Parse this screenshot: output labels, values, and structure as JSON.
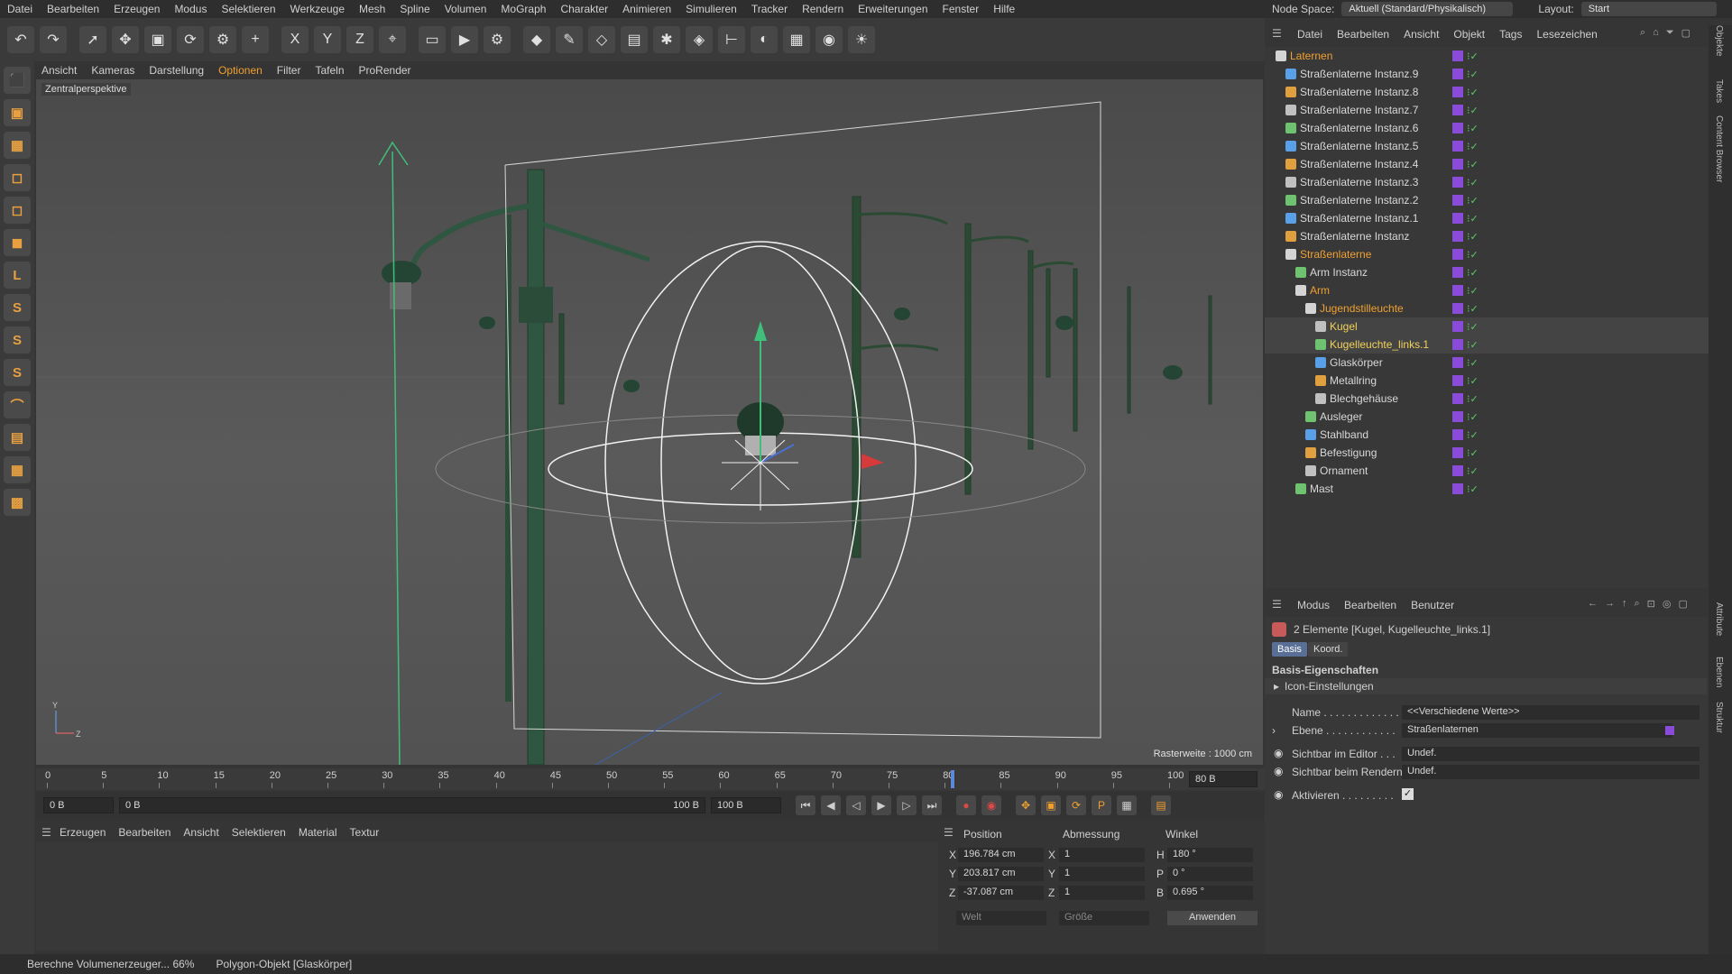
{
  "menu": [
    "Datei",
    "Bearbeiten",
    "Erzeugen",
    "Modus",
    "Selektieren",
    "Werkzeuge",
    "Mesh",
    "Spline",
    "Volumen",
    "MoGraph",
    "Charakter",
    "Animieren",
    "Simulieren",
    "Tracker",
    "Rendern",
    "Erweiterungen",
    "Fenster",
    "Hilfe"
  ],
  "top_right": {
    "node_space_label": "Node Space:",
    "node_space_value": "Aktuell (Standard/Physikalisch)",
    "layout_label": "Layout:",
    "layout_value": "Start"
  },
  "viewport": {
    "menu": [
      "Ansicht",
      "Kameras",
      "Darstellung",
      "Optionen",
      "Filter",
      "Tafeln",
      "ProRender"
    ],
    "active_menu": "Optionen",
    "label": "Zentralperspektive",
    "raster": "Rasterweite : 1000 cm"
  },
  "timeline": {
    "ticks": [
      "0",
      "5",
      "10",
      "15",
      "20",
      "25",
      "30",
      "35",
      "40",
      "45",
      "50",
      "55",
      "60",
      "65",
      "70",
      "75",
      "80",
      "85",
      "90",
      "95",
      "100"
    ],
    "current_frame": "80 B",
    "start": "0 B",
    "range_start": "0 B",
    "range_end": "100 B",
    "end": "100 B"
  },
  "material_menu": [
    "Erzeugen",
    "Bearbeiten",
    "Ansicht",
    "Selektieren",
    "Material",
    "Textur"
  ],
  "coords": {
    "headers": [
      "Position",
      "Abmessung",
      "Winkel"
    ],
    "rows": [
      {
        "axis": "X",
        "pos": "196.784 cm",
        "dim_axis": "X",
        "dim": "1",
        "ang_axis": "H",
        "ang": "180 °"
      },
      {
        "axis": "Y",
        "pos": "203.817 cm",
        "dim_axis": "Y",
        "dim": "1",
        "ang_axis": "P",
        "ang": "0 °"
      },
      {
        "axis": "Z",
        "pos": "-37.087 cm",
        "dim_axis": "Z",
        "dim": "1",
        "ang_axis": "B",
        "ang": "0.695 °"
      }
    ],
    "mode1": "Welt",
    "mode2": "Größe",
    "apply": "Anwenden"
  },
  "status": {
    "progress": "Berechne Volumenerzeuger... 66%",
    "selection": "Polygon-Objekt [Glaskörper]"
  },
  "objects_menu": [
    "Datei",
    "Bearbeiten",
    "Ansicht",
    "Objekt",
    "Tags",
    "Lesezeichen"
  ],
  "objects": [
    {
      "name": "Laternen",
      "indent": 0,
      "style": "orange"
    },
    {
      "name": "Straßenlaterne Instanz.9",
      "indent": 1,
      "style": "normal"
    },
    {
      "name": "Straßenlaterne Instanz.8",
      "indent": 1,
      "style": "normal"
    },
    {
      "name": "Straßenlaterne Instanz.7",
      "indent": 1,
      "style": "normal"
    },
    {
      "name": "Straßenlaterne Instanz.6",
      "indent": 1,
      "style": "normal"
    },
    {
      "name": "Straßenlaterne Instanz.5",
      "indent": 1,
      "style": "normal"
    },
    {
      "name": "Straßenlaterne Instanz.4",
      "indent": 1,
      "style": "normal"
    },
    {
      "name": "Straßenlaterne Instanz.3",
      "indent": 1,
      "style": "normal"
    },
    {
      "name": "Straßenlaterne Instanz.2",
      "indent": 1,
      "style": "normal"
    },
    {
      "name": "Straßenlaterne Instanz.1",
      "indent": 1,
      "style": "normal"
    },
    {
      "name": "Straßenlaterne Instanz",
      "indent": 1,
      "style": "normal"
    },
    {
      "name": "Straßenlaterne",
      "indent": 1,
      "style": "orange"
    },
    {
      "name": "Arm Instanz",
      "indent": 2,
      "style": "normal"
    },
    {
      "name": "Arm",
      "indent": 2,
      "style": "orange"
    },
    {
      "name": "Jugendstilleuchte",
      "indent": 3,
      "style": "orange"
    },
    {
      "name": "Kugel",
      "indent": 4,
      "style": "yellow"
    },
    {
      "name": "Kugelleuchte_links.1",
      "indent": 4,
      "style": "yellow"
    },
    {
      "name": "Glaskörper",
      "indent": 4,
      "style": "normal"
    },
    {
      "name": "Metallring",
      "indent": 4,
      "style": "normal"
    },
    {
      "name": "Blechgehäuse",
      "indent": 4,
      "style": "normal"
    },
    {
      "name": "Ausleger",
      "indent": 3,
      "style": "normal"
    },
    {
      "name": "Stahlband",
      "indent": 3,
      "style": "normal"
    },
    {
      "name": "Befestigung",
      "indent": 3,
      "style": "normal"
    },
    {
      "name": "Ornament",
      "indent": 3,
      "style": "normal"
    },
    {
      "name": "Mast",
      "indent": 2,
      "style": "normal"
    }
  ],
  "attr_menu": [
    "Modus",
    "Bearbeiten",
    "Benutzer"
  ],
  "attributes": {
    "header": "2 Elemente [Kugel, Kugelleuchte_links.1]",
    "tabs": [
      "Basis",
      "Koord."
    ],
    "section": "Basis-Eigenschaften",
    "subsection": "Icon-Einstellungen",
    "name_label": "Name . . . . . . . . . . . . .",
    "name_value": "<<Verschiedene Werte>>",
    "layer_label": "Ebene . . . . . . . . . . . .",
    "layer_value": "Straßenlaternen",
    "editor_label": "Sichtbar im Editor . . .",
    "editor_value": "Undef.",
    "render_label": "Sichtbar beim Rendern",
    "render_value": "Undef.",
    "active_label": "Aktivieren . . . . . . . . .",
    "active_checked": true
  },
  "side_tabs": [
    "Objekte",
    "Takes",
    "Content Browser",
    "Attribute",
    "Ebenen",
    "Struktur"
  ]
}
